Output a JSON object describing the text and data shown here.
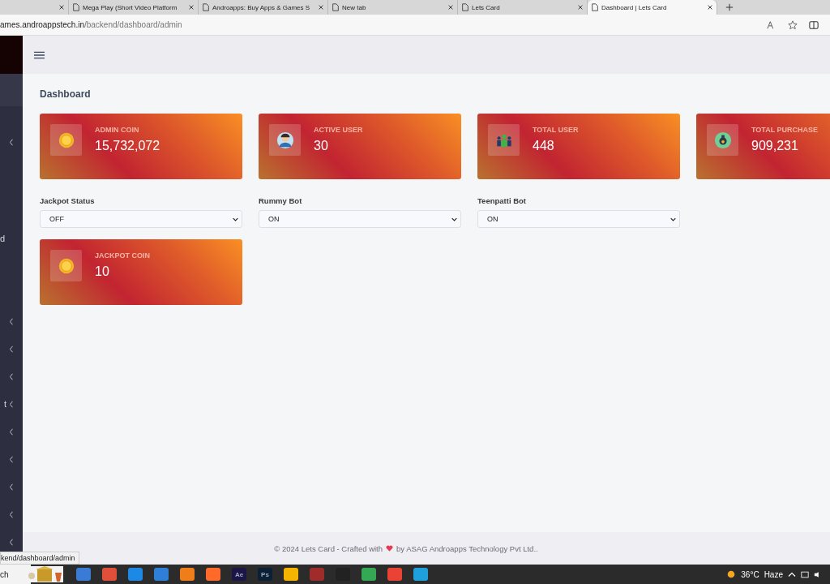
{
  "browser": {
    "tabs": [
      {
        "selected": false
      },
      {
        "title": "Mega Play (Short Video Platform",
        "selected": false
      },
      {
        "title": "Androapps: Buy Apps & Games S",
        "selected": false
      },
      {
        "title": "New tab",
        "selected": false
      },
      {
        "title": "Lets Card",
        "selected": false
      },
      {
        "title": "Dashboard | Lets Card",
        "selected": true
      }
    ],
    "address": {
      "host": "ames.androappstech.in",
      "path": "/backend/dashboard/admin"
    }
  },
  "sidebar": {
    "items": [
      {
        "kind": "group"
      },
      {
        "kind": "link",
        "label": "d"
      },
      {
        "kind": "group"
      },
      {
        "kind": "group"
      },
      {
        "kind": "group"
      },
      {
        "kind": "group",
        "label": "t"
      },
      {
        "kind": "group"
      },
      {
        "kind": "group"
      },
      {
        "kind": "group"
      },
      {
        "kind": "group"
      },
      {
        "kind": "group"
      }
    ]
  },
  "page": {
    "title": "Dashboard",
    "stats": [
      {
        "label": "ADMIN COIN",
        "value": "15,732,072",
        "kind": "coin"
      },
      {
        "label": "ACTIVE USER",
        "value": "30",
        "kind": "user"
      },
      {
        "label": "TOTAL USER",
        "value": "448",
        "kind": "users"
      },
      {
        "label": "TOTAL PURCHASE",
        "value": "909,231",
        "kind": "purchase"
      }
    ],
    "settings": [
      {
        "label": "Jackpot Status",
        "value": "OFF"
      },
      {
        "label": "Rummy Bot",
        "value": "ON"
      },
      {
        "label": "Teenpatti Bot",
        "value": "ON"
      }
    ],
    "jackpot": {
      "label": "JACKPOT COIN",
      "value": "10",
      "kind": "coin"
    }
  },
  "footer": {
    "before": "© 2024 Lets Card - Crafted with",
    "after": "by ASAG Androapps Technology Pvt Ltd.."
  },
  "status_url": "kend/dashboard/admin",
  "taskbar": {
    "search": "ch",
    "apps": [
      {
        "color": "#3a7bd5"
      },
      {
        "color": "#e04f3a"
      },
      {
        "color": "#1e88e5"
      },
      {
        "color": "#2f7fd8"
      },
      {
        "color": "#ef7d1a"
      },
      {
        "color": "#ff6a2b"
      },
      {
        "color": "#1c1648",
        "label": "Ae"
      },
      {
        "color": "#0b2036",
        "label": "Ps"
      },
      {
        "color": "#f4b400"
      },
      {
        "color": "#a02b2b"
      },
      {
        "color": "#222222"
      },
      {
        "color": "#34a853"
      },
      {
        "color": "#ea4335"
      },
      {
        "color": "#1ea0dc"
      }
    ],
    "temperature": "36°C",
    "weather": "Haze"
  }
}
